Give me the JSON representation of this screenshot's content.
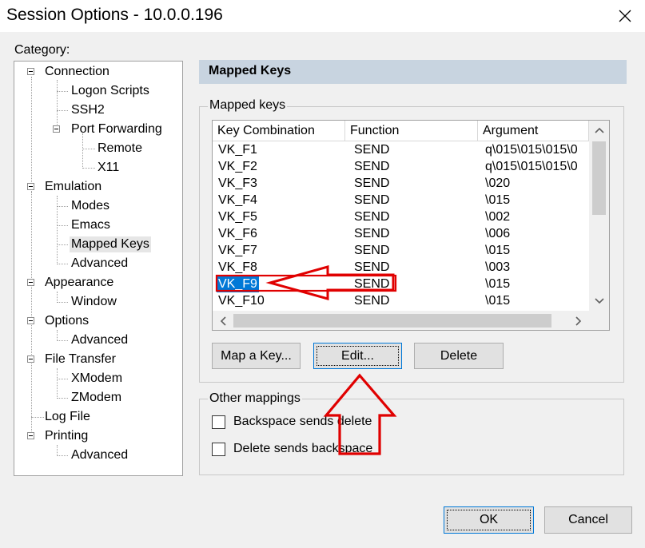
{
  "window": {
    "title": "Session Options - 10.0.0.196"
  },
  "category": {
    "label": "Category:",
    "tree": [
      {
        "label": "Connection"
      },
      {
        "label": "Logon Scripts"
      },
      {
        "label": "SSH2"
      },
      {
        "label": "Port Forwarding"
      },
      {
        "label": "Remote"
      },
      {
        "label": "X11"
      },
      {
        "label": "Emulation"
      },
      {
        "label": "Modes"
      },
      {
        "label": "Emacs"
      },
      {
        "label": "Mapped Keys"
      },
      {
        "label": "Advanced"
      },
      {
        "label": "Appearance"
      },
      {
        "label": "Window"
      },
      {
        "label": "Options"
      },
      {
        "label": "Advanced"
      },
      {
        "label": "File Transfer"
      },
      {
        "label": "XModem"
      },
      {
        "label": "ZModem"
      },
      {
        "label": "Log File"
      },
      {
        "label": "Printing"
      },
      {
        "label": "Advanced"
      }
    ]
  },
  "panel": {
    "header": "Mapped Keys",
    "mapped_group": "Mapped keys",
    "columns": [
      "Key Combination",
      "Function",
      "Argument"
    ],
    "rows": [
      {
        "key": "VK_F1",
        "func": "SEND",
        "arg": "q\\015\\015\\015\\0"
      },
      {
        "key": "VK_F2",
        "func": "SEND",
        "arg": "q\\015\\015\\015\\0"
      },
      {
        "key": "VK_F3",
        "func": "SEND",
        "arg": "\\020"
      },
      {
        "key": "VK_F4",
        "func": "SEND",
        "arg": "\\015"
      },
      {
        "key": "VK_F5",
        "func": "SEND",
        "arg": "\\002"
      },
      {
        "key": "VK_F6",
        "func": "SEND",
        "arg": "\\006"
      },
      {
        "key": "VK_F7",
        "func": "SEND",
        "arg": "\\015"
      },
      {
        "key": "VK_F8",
        "func": "SEND",
        "arg": "\\003"
      },
      {
        "key": "VK_F9",
        "func": "SEND",
        "arg": "\\015"
      },
      {
        "key": "VK_F10",
        "func": "SEND",
        "arg": "\\015"
      }
    ],
    "selected_row": 8,
    "buttons": {
      "map": "Map a Key...",
      "edit": "Edit...",
      "delete": "Delete"
    },
    "other_group": "Other mappings",
    "backspace_sends_delete": "Backspace sends delete",
    "delete_sends_backspace": "Delete sends backspace"
  },
  "footer": {
    "ok": "OK",
    "cancel": "Cancel"
  },
  "colors": {
    "header_bg": "#c8d4e0",
    "selection": "#0078d7",
    "annotation": "#e00000"
  },
  "icons": {
    "close": "close-icon",
    "scroll_up": "chevron-up-icon",
    "scroll_down": "chevron-down-icon",
    "scroll_left": "chevron-left-icon",
    "scroll_right": "chevron-right-icon"
  }
}
